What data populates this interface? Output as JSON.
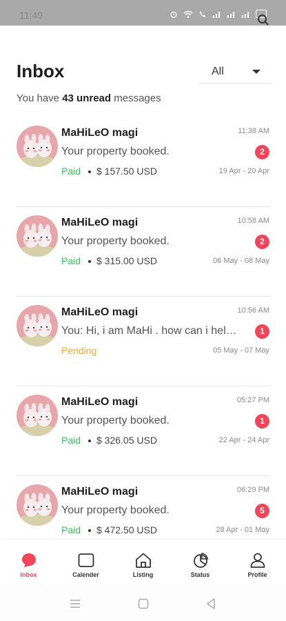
{
  "status_bar": {
    "time": "11:49"
  },
  "header": {
    "title": "Inbox",
    "filter_value": "All"
  },
  "summary": {
    "prefix": "You have ",
    "count_text": "43 unread",
    "suffix": " messages"
  },
  "messages": [
    {
      "name": "MaHiLeO magi",
      "time": "11:38 AM",
      "preview": "Your property booked.",
      "badge": "2",
      "status": "Paid",
      "price": "$ 157.50 USD",
      "dates": "19 Apr - 20 Apr"
    },
    {
      "name": "MaHiLeO magi",
      "time": "10:58 AM",
      "preview": "Your property booked.",
      "badge": "2",
      "status": "Paid",
      "price": "$ 315.00 USD",
      "dates": "06 May - 08 May"
    },
    {
      "name": "MaHiLeO magi",
      "time": "10:56 AM",
      "preview": "You: Hi, i am MaHi . how can i help you?",
      "badge": "1",
      "status": "Pending",
      "price": "",
      "dates": "05 May - 07 May"
    },
    {
      "name": "MaHiLeO magi",
      "time": "05:27 PM",
      "preview": "Your property booked.",
      "badge": "1",
      "status": "Paid",
      "price": "$ 326.05 USD",
      "dates": "22 Apr - 24 Apr"
    },
    {
      "name": "MaHiLeO magi",
      "time": "06:29 PM",
      "preview": "Your property booked.",
      "badge": "5",
      "status": "Paid",
      "price": "$ 472.50 USD",
      "dates": "28 Apr - 01 May"
    }
  ],
  "tabs": [
    {
      "label": "Inbox",
      "icon": "chat-bubble-icon",
      "active": true
    },
    {
      "label": "Calender",
      "icon": "calendar-icon",
      "active": false
    },
    {
      "label": "Listing",
      "icon": "home-icon",
      "active": false
    },
    {
      "label": "Status",
      "icon": "pie-chart-icon",
      "active": false
    },
    {
      "label": "Profile",
      "icon": "user-icon",
      "active": false
    }
  ],
  "colors": {
    "accent": "#f2455a",
    "paid": "#3bbf5b",
    "pending": "#f2a93b"
  }
}
